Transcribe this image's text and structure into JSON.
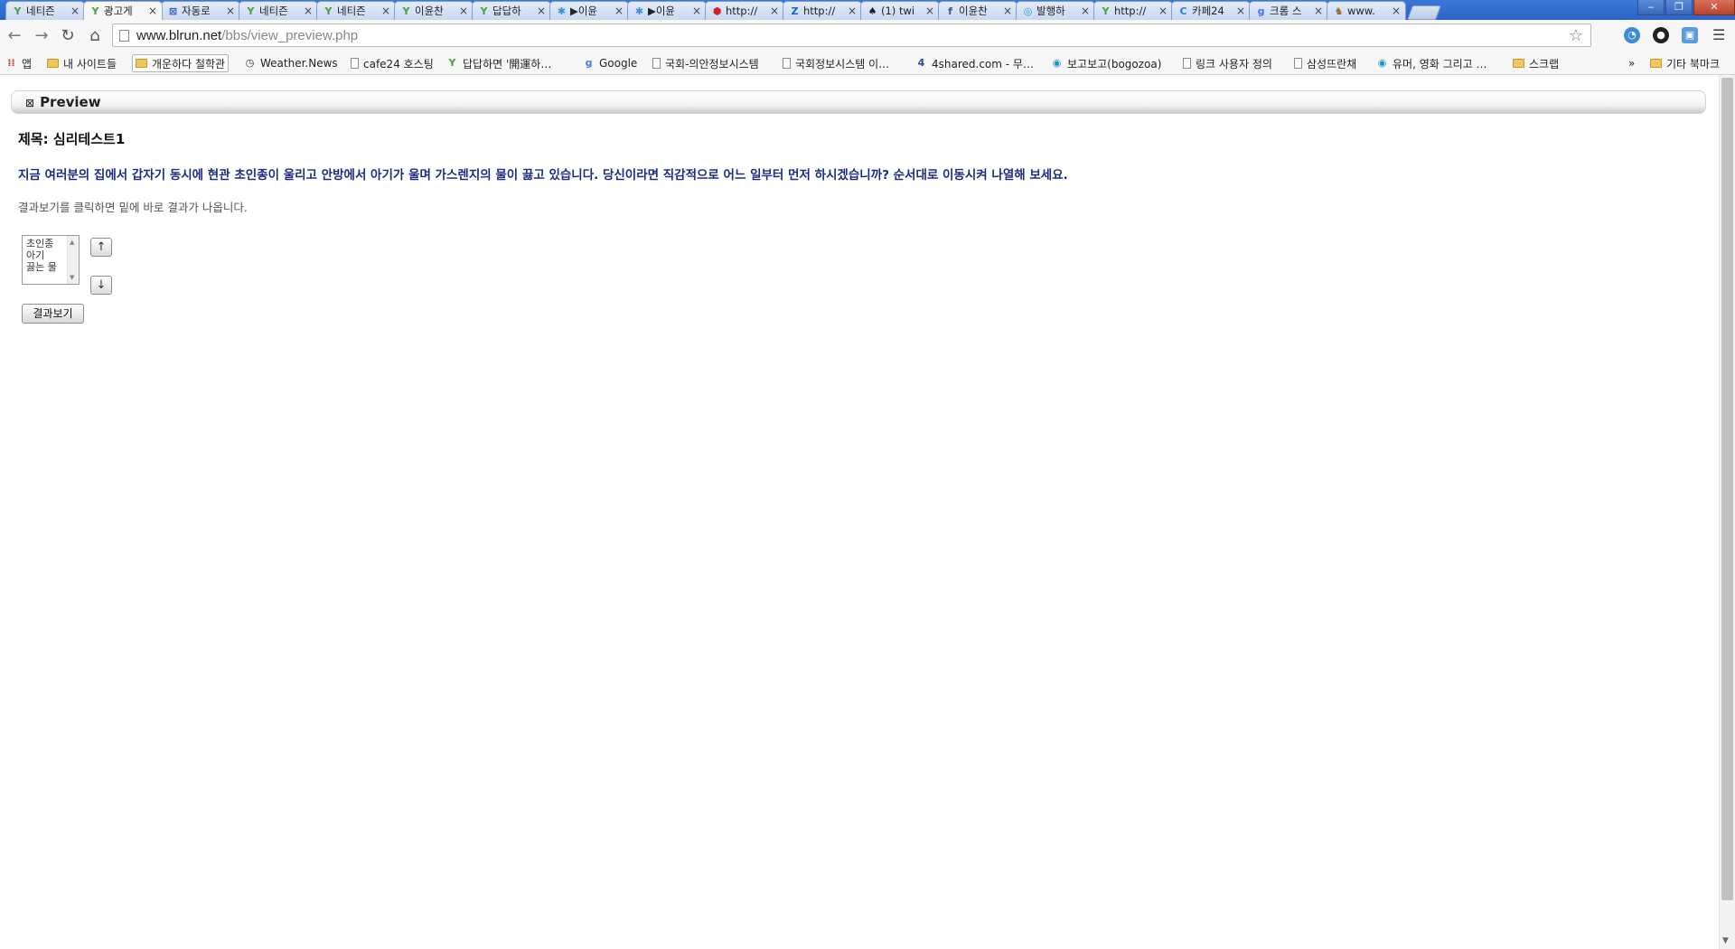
{
  "browser": {
    "tabs": [
      {
        "label": "네티즌",
        "icon": "sprout-icon",
        "color": "#48a23a",
        "glyph": "Y"
      },
      {
        "label": "광고게",
        "icon": "sprout-icon",
        "color": "#48a23a",
        "glyph": "Y",
        "active": true
      },
      {
        "label": "자동로",
        "icon": "box-icon",
        "color": "#2e5db8",
        "glyph": "⊠"
      },
      {
        "label": "네티즌",
        "icon": "sprout-icon",
        "color": "#48a23a",
        "glyph": "Y"
      },
      {
        "label": "네티즌",
        "icon": "sprout-icon",
        "color": "#48a23a",
        "glyph": "Y"
      },
      {
        "label": "이윤찬",
        "icon": "sprout-icon",
        "color": "#48a23a",
        "glyph": "Y"
      },
      {
        "label": "답답하",
        "icon": "sprout-icon",
        "color": "#48a23a",
        "glyph": "Y"
      },
      {
        "label": "▶이윤",
        "icon": "person-icon",
        "color": "#3b8fd6",
        "glyph": "✱"
      },
      {
        "label": "▶이윤",
        "icon": "person-icon",
        "color": "#3b8fd6",
        "glyph": "✱"
      },
      {
        "label": "http://",
        "icon": "red-hex-icon",
        "color": "#d0202a",
        "glyph": "⬢"
      },
      {
        "label": "http://",
        "icon": "z-icon",
        "color": "#1e5fc2",
        "glyph": "Z"
      },
      {
        "label": "(1) twi",
        "icon": "pin-icon",
        "color": "#222222",
        "glyph": "♠"
      },
      {
        "label": "이윤찬",
        "icon": "facebook-icon",
        "color": "#3b5998",
        "glyph": "f"
      },
      {
        "label": "발행하",
        "icon": "ring-icon",
        "color": "#1aa0c8",
        "glyph": "◎"
      },
      {
        "label": "http://",
        "icon": "sprout-icon",
        "color": "#48a23a",
        "glyph": "Y"
      },
      {
        "label": "카페24",
        "icon": "c-icon",
        "color": "#2e7bd6",
        "glyph": "C"
      },
      {
        "label": "크롬 스",
        "icon": "google-g-icon",
        "color": "#4a78e6",
        "glyph": "g"
      },
      {
        "label": "www.",
        "icon": "cat-icon",
        "color": "#9a6b3a",
        "glyph": "♞"
      }
    ],
    "url_host": "www.blrun.net",
    "url_path": "/bbs/view_preview.php"
  },
  "bookmarks": [
    {
      "label": "앱",
      "icon": "apps-grid-icon"
    },
    {
      "label": "내 사이트들",
      "icon": "folder-icon"
    },
    {
      "label": "개운하다 철학관",
      "icon": "folder-icon",
      "highlight": true
    },
    {
      "label": "Weather.News",
      "icon": "clock-icon"
    },
    {
      "label": "cafe24 호스팅",
      "icon": "page-icon"
    },
    {
      "label": "답답하면 '開運하…",
      "icon": "sprout-icon"
    },
    {
      "label": "Google",
      "icon": "google-icon"
    },
    {
      "label": "국회-의안정보시스템",
      "icon": "page-icon"
    },
    {
      "label": "국회정보시스템 이…",
      "icon": "page-icon"
    },
    {
      "label": "4shared.com - 무…",
      "icon": "four-icon"
    },
    {
      "label": "보고보고(bogozoa)",
      "icon": "circle-icon"
    },
    {
      "label": "링크 사용자 정의",
      "icon": "page-icon"
    },
    {
      "label": "삼성뜨란채",
      "icon": "page-icon"
    },
    {
      "label": "유머, 영화 그리고 …",
      "icon": "circle-icon"
    },
    {
      "label": "스크랩",
      "icon": "folder-icon"
    }
  ],
  "bookmarks_overflow": "»",
  "other_bookmarks": "기타 북마크",
  "page": {
    "preview_title": "Preview",
    "preview_mark": "⊠",
    "post_title": "제목: 심리테스트1",
    "question": "지금 여러분의 집에서 갑자기 동시에 현관 초인종이 울리고 안방에서 아기가 울며 가스렌지의 물이 끓고 있습니다. 당신이라면 직감적으로 어느 일부터 먼저 하시겠습니까? 순서대로 이동시켜 나열해 보세요.",
    "hint": "결과보기를 클릭하면 밑에 바로 결과가 나옵니다.",
    "options": [
      "초인종",
      "아기",
      "끓는 물"
    ],
    "up_label": "↑",
    "down_label": "↓",
    "result_button": "결과보기"
  },
  "colors": {
    "question_text": "#1d2b86",
    "tabstrip": "#3a77d8"
  }
}
